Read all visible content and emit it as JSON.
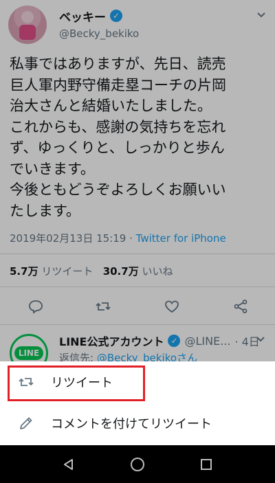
{
  "tweet": {
    "name": "ベッキー",
    "handle": "@Becky_bekiko",
    "body_lines": [
      "私事ではありますが、先日、読売",
      "巨人軍内野守備走塁コーチの片岡",
      "治大さんと結婚いたしました。",
      "これからも、感謝の気持ちを忘れ",
      "ず、ゆっくりと、しっかりと歩ん",
      "でいきます。",
      "今後ともどうぞよろしくお願いい",
      "たします。"
    ],
    "timestamp": "2019年02月13日 15:19",
    "separator": " · ",
    "source": "Twitter for iPhone",
    "retweets_count": "5.7万",
    "retweets_label": "リツイート",
    "likes_count": "30.7万",
    "likes_label": "いいね"
  },
  "reply": {
    "logo_text": "LINE",
    "name": "LINE公式アカウント",
    "handle": "@LINE...",
    "time": "· 4日",
    "to_label": "返信先: ",
    "to_mention": "@Becky_bekiko",
    "to_suffix": "さん"
  },
  "sheet": {
    "retweet_label": "リツイート",
    "quote_label": "コメントを付けてリツイート"
  },
  "colors": {
    "accent": "#1da1f2",
    "highlight": "#e21f26",
    "line_green": "#06c755"
  }
}
